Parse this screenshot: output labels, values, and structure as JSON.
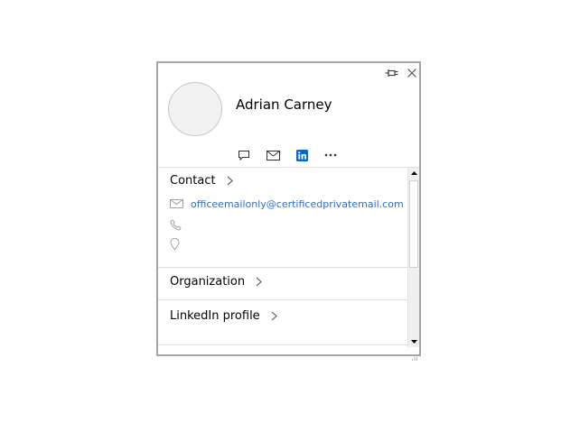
{
  "person": {
    "name": "Adrian Carney"
  },
  "window_controls": {
    "pin_icon": "pin-icon",
    "close_icon": "close-icon"
  },
  "actions": [
    {
      "icon": "chat-icon"
    },
    {
      "icon": "mail-icon"
    },
    {
      "icon": "linkedin-icon"
    },
    {
      "icon": "more-icon"
    }
  ],
  "sections": {
    "contact": {
      "title": "Contact",
      "email": "officeemailonly@certificedprivatemail.com"
    },
    "organization": {
      "title": "Organization"
    },
    "linkedin": {
      "title": "LinkedIn profile"
    }
  },
  "colors": {
    "link": "#2f6fc6",
    "linkedin_blue": "#0a66c2",
    "border": "#a6a6a6"
  }
}
